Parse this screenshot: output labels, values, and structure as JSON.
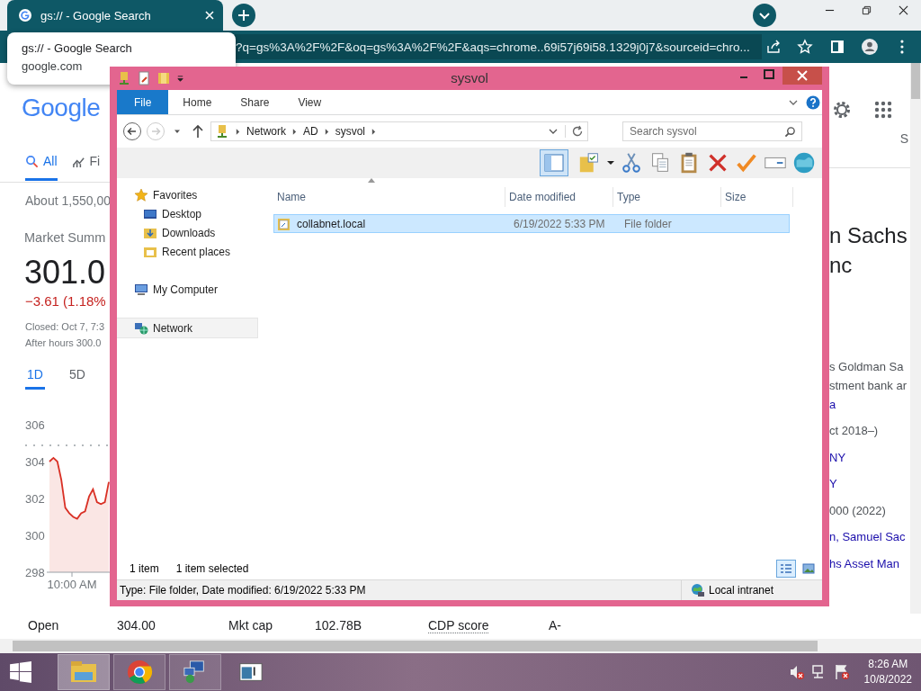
{
  "browser": {
    "tab": {
      "title": "gs:// - Google Search",
      "selected": true
    },
    "tooltip": {
      "title": "gs:// - Google Search",
      "url": "google.com"
    },
    "address": "?q=gs%3A%2F%2F&oq=gs%3A%2F%2F&aqs=chrome..69i57j69i58.1329j0j7&sourceid=chro..."
  },
  "page": {
    "logo": "Google",
    "tabs": [
      {
        "label": "All",
        "kind": "search",
        "selected": true
      },
      {
        "label": "Fi",
        "kind": "finance",
        "selected": false
      }
    ],
    "tab_right": "S",
    "results_count": "About 1,550,00",
    "market_title": "Market Summ",
    "price": "301.0",
    "change": "−3.61 (1.18%",
    "closed": "Closed: Oct 7, 7:3",
    "after_hours": "After hours 300.0",
    "ranges": [
      {
        "label": "1D",
        "selected": true
      },
      {
        "label": "5D",
        "selected": false
      }
    ],
    "chart_data": {
      "type": "area",
      "ylim": [
        298,
        306
      ],
      "yticks": [
        298,
        300,
        302,
        304,
        306
      ],
      "series": [
        {
          "color": "#d93025",
          "values": [
            304.0,
            304.2,
            304.0,
            303.0,
            301.5,
            301.2,
            301.0,
            300.9,
            301.2,
            301.3,
            302.1,
            302.5,
            301.8,
            301.7,
            301.8,
            302.9
          ]
        }
      ]
    },
    "chart_time_label": "10:00 AM",
    "stats": [
      {
        "label": "Open",
        "value": "304.00",
        "link": false
      },
      {
        "label": "Mkt cap",
        "value": "102.78B",
        "link": false
      },
      {
        "label": "CDP score",
        "value": "A-",
        "link": true
      }
    ],
    "panel": {
      "title_lines": [
        "n Sachs",
        "nc"
      ],
      "description": [
        "s Goldman Sa",
        "stment bank ar"
      ],
      "source": "a",
      "facts": [
        {
          "text": "ct 2018–)",
          "link": false
        },
        {
          "text": "NY",
          "link": true
        },
        {
          "text": "Y",
          "link": true
        },
        {
          "text": "000 (2022)",
          "link": false
        },
        {
          "text": "n, Samuel Sac",
          "link": true
        },
        {
          "text": "hs Asset Man",
          "link": true
        }
      ]
    }
  },
  "explorer": {
    "title": "sysvol",
    "ribbon_tabs": [
      {
        "label": "File",
        "selected": true
      },
      {
        "label": "Home",
        "selected": false
      },
      {
        "label": "Share",
        "selected": false
      },
      {
        "label": "View",
        "selected": false
      }
    ],
    "path": [
      "Network",
      "AD",
      "sysvol"
    ],
    "search": {
      "placeholder": "Search sysvol"
    },
    "nav": [
      {
        "label": "Favorites",
        "kind": "favorites",
        "selected": false,
        "children": [
          {
            "label": "Desktop",
            "kind": "desktop",
            "selected": false
          },
          {
            "label": "Downloads",
            "kind": "downloads",
            "selected": false
          },
          {
            "label": "Recent places",
            "kind": "recent",
            "selected": false
          }
        ]
      },
      {
        "label": "My Computer",
        "kind": "computer",
        "selected": false
      },
      {
        "label": "Network",
        "kind": "network",
        "selected": true
      }
    ],
    "columns": [
      "Name",
      "Date modified",
      "Type",
      "Size"
    ],
    "rows": [
      {
        "name": "collabnet.local",
        "date": "6/19/2022 5:33 PM",
        "type": "File folder",
        "selected": true
      }
    ],
    "item_count": "1 item",
    "selection": "1 item selected",
    "views": [
      {
        "kind": "details",
        "selected": true
      },
      {
        "kind": "thumbnails",
        "selected": false
      }
    ],
    "details": "Type: File folder, Date modified: 6/19/2022 5:33 PM",
    "zone": "Local intranet"
  },
  "taskbar": {
    "apps": [
      {
        "kind": "explorer",
        "selected": true
      },
      {
        "kind": "chrome",
        "selected": false
      },
      {
        "kind": "network",
        "selected": false
      },
      {
        "kind": "console",
        "selected": false
      }
    ],
    "time": "8:26 AM",
    "date": "10/8/2022"
  }
}
